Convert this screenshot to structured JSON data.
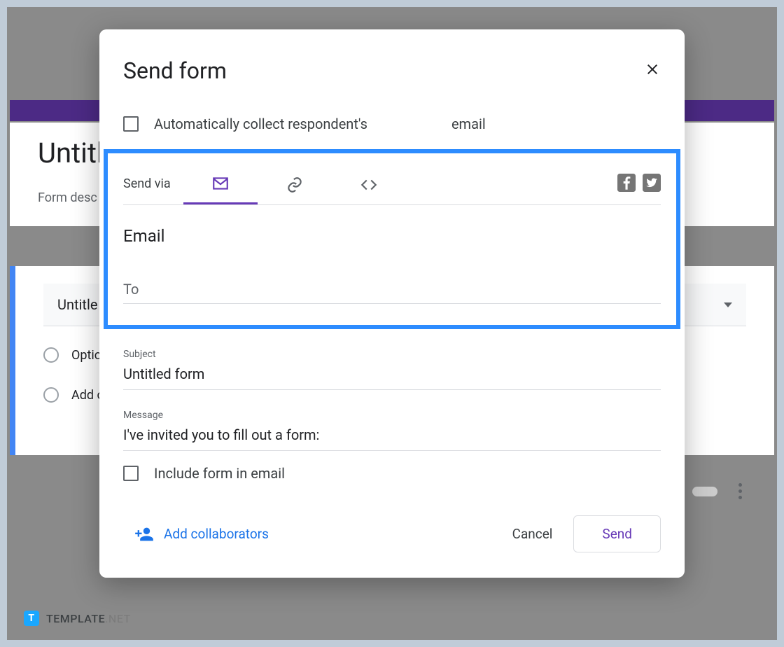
{
  "background": {
    "form_title": "Untitled",
    "form_desc": "Form desc",
    "question_title": "Untitle",
    "option1": "Optio",
    "option2": "Add o"
  },
  "dialog": {
    "title": "Send form",
    "collect_email_label_a": "Automatically collect respondent's",
    "collect_email_label_b": "email",
    "send_via_label": "Send via",
    "section_heading": "Email",
    "to_placeholder": "To",
    "subject_label": "Subject",
    "subject_value": "Untitled form",
    "message_label": "Message",
    "message_value": "I've invited you to fill out a form:",
    "include_form_label": "Include form in email",
    "add_collab": "Add collaborators",
    "cancel": "Cancel",
    "send": "Send"
  },
  "watermark": {
    "badge": "T",
    "text1": "TEMPLATE",
    "text2": ".NET"
  }
}
